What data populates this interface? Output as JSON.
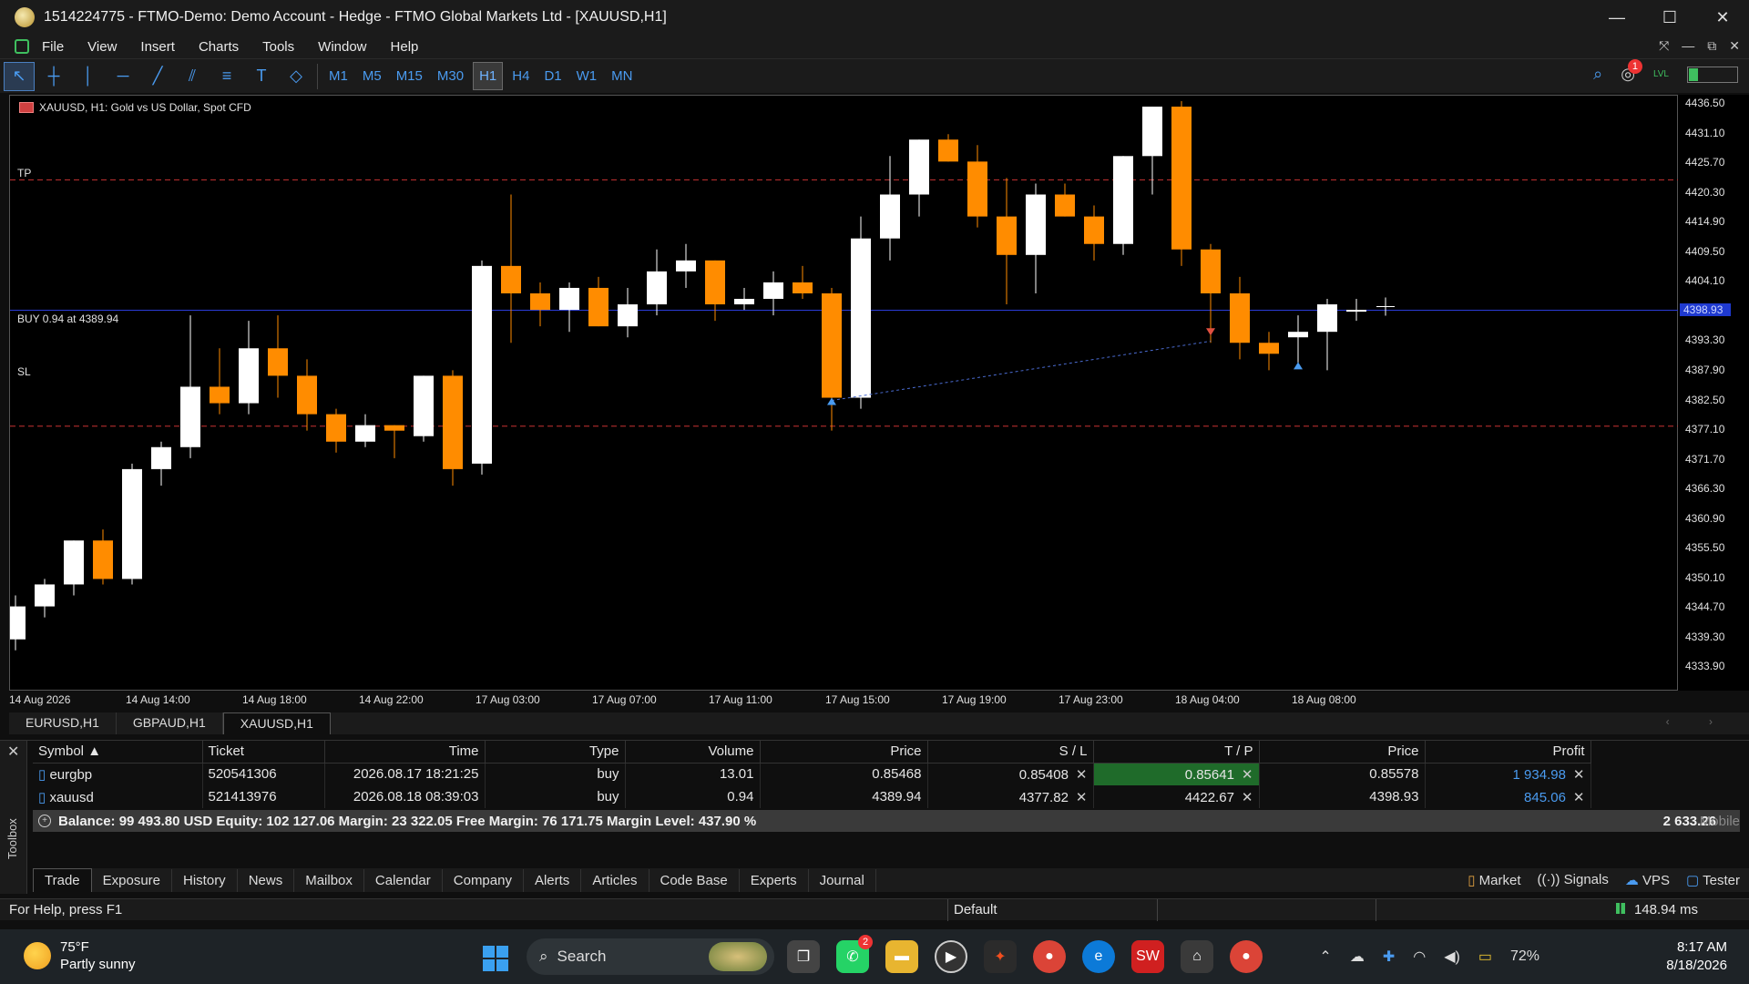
{
  "window": {
    "title": "1514224775 - FTMO-Demo: Demo Account - Hedge - FTMO Global Markets Ltd - [XAUUSD,H1]",
    "controls": [
      "—",
      "☐",
      "✕"
    ]
  },
  "menu": [
    "File",
    "View",
    "Insert",
    "Charts",
    "Tools",
    "Window",
    "Help"
  ],
  "menu_right_icons": [
    "⤧",
    "—",
    "⧉",
    "✕"
  ],
  "toolbar": {
    "timeframes": [
      "M1",
      "M5",
      "M15",
      "M30",
      "H1",
      "H4",
      "D1",
      "W1",
      "MN"
    ],
    "active_timeframe": "H1",
    "notification_count": "1",
    "level_label": "LVL"
  },
  "chart": {
    "header": "XAUUSD, H1:  Gold vs US Dollar, Spot CFD",
    "tp_label": "TP",
    "sl_label": "SL",
    "buy_label": "BUY 0.94 at 4389.94",
    "current_price_label": "4398.93",
    "colors": {
      "bull": "#ffffff",
      "bear": "#ff8c00",
      "tp_sl_line": "#c83232",
      "price_line": "#2a3bd6"
    }
  },
  "chart_data": {
    "type": "candlestick",
    "symbol": "XAUUSD",
    "timeframe": "H1",
    "ylim": [
      4329.5,
      4438
    ],
    "price_ticks": [
      "4436.50",
      "4431.10",
      "4425.70",
      "4420.30",
      "4414.90",
      "4409.50",
      "4404.10",
      "4398.93",
      "4393.30",
      "4387.90",
      "4382.50",
      "4377.10",
      "4371.70",
      "4366.30",
      "4360.90",
      "4355.50",
      "4350.10",
      "4344.70",
      "4339.30",
      "4333.90"
    ],
    "time_ticks": [
      "14 Aug 2026",
      "14 Aug 14:00",
      "14 Aug 18:00",
      "14 Aug 22:00",
      "17 Aug 03:00",
      "17 Aug 07:00",
      "17 Aug 11:00",
      "17 Aug 15:00",
      "17 Aug 19:00",
      "17 Aug 23:00",
      "18 Aug 04:00",
      "18 Aug 08:00"
    ],
    "tp": 4422.67,
    "sl": 4377.82,
    "entry": 4389.94,
    "current": 4398.93,
    "ohlc": [
      [
        4339,
        4347,
        4337,
        4345
      ],
      [
        4345,
        4350,
        4343,
        4349
      ],
      [
        4349,
        4357,
        4347,
        4357
      ],
      [
        4357,
        4359,
        4349,
        4350
      ],
      [
        4350,
        4371,
        4349,
        4370
      ],
      [
        4370,
        4375,
        4367,
        4374
      ],
      [
        4374,
        4398,
        4372,
        4385
      ],
      [
        4385,
        4392,
        4380,
        4382
      ],
      [
        4382,
        4397,
        4380,
        4392
      ],
      [
        4392,
        4398,
        4383,
        4387
      ],
      [
        4387,
        4390,
        4377,
        4380
      ],
      [
        4380,
        4381,
        4373,
        4375
      ],
      [
        4375,
        4380,
        4374,
        4378
      ],
      [
        4378,
        4378,
        4372,
        4377
      ],
      [
        4376,
        4387,
        4375,
        4387
      ],
      [
        4387,
        4388,
        4367,
        4370
      ],
      [
        4371,
        4408,
        4369,
        4407
      ],
      [
        4407,
        4420,
        4393,
        4402
      ],
      [
        4402,
        4404,
        4396,
        4399
      ],
      [
        4399,
        4404,
        4395,
        4403
      ],
      [
        4403,
        4405,
        4396,
        4396
      ],
      [
        4396,
        4403,
        4394,
        4400
      ],
      [
        4400,
        4410,
        4398,
        4406
      ],
      [
        4406,
        4411,
        4403,
        4408
      ],
      [
        4408,
        4408,
        4397,
        4400
      ],
      [
        4400,
        4403,
        4399,
        4401
      ],
      [
        4401,
        4406,
        4398,
        4404
      ],
      [
        4404,
        4407,
        4401,
        4402
      ],
      [
        4402,
        4403,
        4377,
        4383
      ],
      [
        4383,
        4416,
        4381,
        4412
      ],
      [
        4412,
        4427,
        4408,
        4420
      ],
      [
        4420,
        4430,
        4416,
        4430
      ],
      [
        4430,
        4431,
        4426,
        4426
      ],
      [
        4426,
        4429,
        4414,
        4416
      ],
      [
        4416,
        4423,
        4400,
        4409
      ],
      [
        4409,
        4422,
        4402,
        4420
      ],
      [
        4420,
        4422,
        4416,
        4416
      ],
      [
        4416,
        4418,
        4408,
        4411
      ],
      [
        4411,
        4427,
        4409,
        4427
      ],
      [
        4427,
        4436,
        4420,
        4436
      ],
      [
        4436,
        4437,
        4407,
        4410
      ],
      [
        4410,
        4411,
        4393,
        4402
      ],
      [
        4402,
        4405,
        4390,
        4393
      ],
      [
        4393,
        4395,
        4388,
        4391
      ],
      [
        4394,
        4398,
        4389,
        4395
      ],
      [
        4395,
        4401,
        4388,
        4400
      ],
      [
        4399,
        4401,
        4397,
        4399
      ]
    ]
  },
  "chart_tabs": [
    "EURUSD,H1",
    "GBPAUD,H1",
    "XAUUSD,H1"
  ],
  "active_chart_tab": "XAUUSD,H1",
  "trade_table": {
    "columns": [
      "Symbol",
      "Ticket",
      "Time",
      "Type",
      "Volume",
      "Price",
      "S / L",
      "T / P",
      "Price",
      "Profit"
    ],
    "rows": [
      [
        "eurgbp",
        "520541306",
        "2026.08.17 18:21:25",
        "buy",
        "13.01",
        "0.85468",
        "0.85408",
        "0.85641",
        "0.85578",
        "1 934.98"
      ],
      [
        "xauusd",
        "521413976",
        "2026.08.18 08:39:03",
        "buy",
        "0.94",
        "4389.94",
        "4377.82",
        "4422.67",
        "4398.93",
        "845.06"
      ]
    ],
    "balance_line": "Balance: 99 493.80 USD  Equity: 102 127.06  Margin: 23 322.05  Free Margin: 76 171.75  Margin Level: 437.90 %",
    "total_profit": "2 633.26",
    "mobile_label": "Mobile"
  },
  "toolbox_label": "Toolbox",
  "bottom_tabs": [
    "Trade",
    "Exposure",
    "History",
    "News",
    "Mailbox",
    "Calendar",
    "Company",
    "Alerts",
    "Articles",
    "Code Base",
    "Experts",
    "Journal"
  ],
  "active_bottom_tab": "Trade",
  "bottom_right": [
    "Market",
    "Signals",
    "VPS",
    "Tester"
  ],
  "status": {
    "help": "For Help, press F1",
    "profile": "Default",
    "ping": "148.94 ms"
  },
  "taskbar": {
    "temperature": "75°F",
    "weather": "Partly sunny",
    "search": "Search",
    "whatsapp_badge": "2",
    "battery": "72%",
    "time": "8:17 AM",
    "date": "8/18/2026"
  }
}
